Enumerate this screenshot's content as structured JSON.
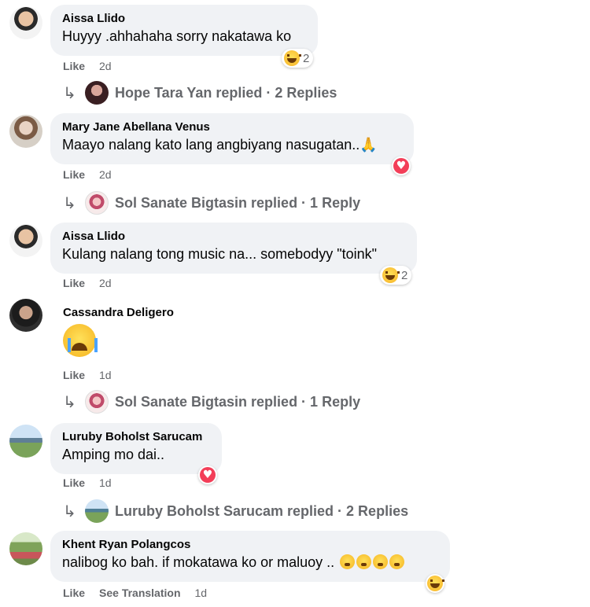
{
  "comments": [
    {
      "name": "Aissa Llido",
      "text": "Huyyy .ahhahaha sorry nakatawa ko",
      "reaction_count": "2",
      "like": "Like",
      "time": "2d",
      "replies": "Hope Tara Yan replied · 2 Replies"
    },
    {
      "name": "Mary Jane Abellana Venus",
      "text": "Maayo nalang kato lang angbiyang nasugatan..🙏",
      "like": "Like",
      "time": "2d",
      "replies": "Sol Sanate Bigtasin replied · 1 Reply"
    },
    {
      "name": "Aissa Llido",
      "text": "Kulang nalang tong music na... somebodyy \"toink\"",
      "reaction_count": "2",
      "like": "Like",
      "time": "2d"
    },
    {
      "name": "Cassandra Deligero",
      "like": "Like",
      "time": "1d",
      "replies": "Sol Sanate Bigtasin replied · 1 Reply"
    },
    {
      "name": "Luruby Boholst Sarucam",
      "text": "Amping mo dai..",
      "like": "Like",
      "time": "1d",
      "replies": "Luruby Boholst Sarucam replied · 2 Replies"
    },
    {
      "name": "Khent Ryan Polangcos",
      "text": "nalibog ko bah. if mokatawa ko or maluoy ..",
      "like": "Like",
      "see_translation": "See Translation",
      "time": "1d"
    }
  ],
  "icons": {
    "reply_arrow": "reply-arrow-icon",
    "haha": "haha-reaction-icon",
    "love": "love-reaction-icon",
    "crying": "crying-emoji",
    "flushed": "flushed-emoji"
  },
  "colors": {
    "bubble": "#f0f2f5",
    "secondary_text": "#65676b",
    "love": "#f33e58",
    "haha": "#f7b125"
  }
}
